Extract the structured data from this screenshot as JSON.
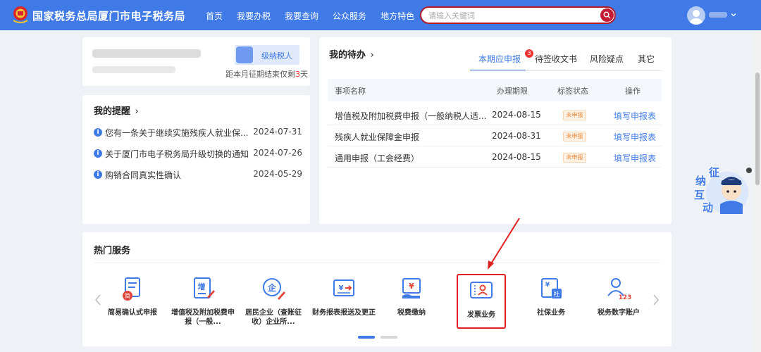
{
  "header": {
    "title": "国家税务总局厦门市电子税务局",
    "nav": [
      "首页",
      "我要办税",
      "我要查询",
      "公众服务",
      "地方特色"
    ],
    "search_placeholder": "请输入关键词"
  },
  "profile": {
    "taxpayer_type": "级纳税人",
    "deadline_prefix": "距本月征期结束仅剩",
    "deadline_days": "3",
    "deadline_suffix": "天"
  },
  "reminder": {
    "title": "我的提醒",
    "items": [
      {
        "text": "您有一条关于继续实施残疾人就业保...",
        "date": "2024-07-31"
      },
      {
        "text": "关于厦门市电子税务局升级切换的通知",
        "date": "2024-07-26"
      },
      {
        "text": "购销合同真实性确认",
        "date": "2024-05-29"
      }
    ]
  },
  "todo": {
    "title": "我的待办",
    "tabs": [
      "本期应申报",
      "待签收文书",
      "风险疑点",
      "其它"
    ],
    "active_tab_badge": "3",
    "columns": [
      "事项名称",
      "办理期限",
      "标签状态",
      "操作"
    ],
    "rows": [
      {
        "name": "增值税及附加税费申报（一般纳税人适...",
        "deadline": "2024-08-15",
        "status": "未申报",
        "action": "填写申报表"
      },
      {
        "name": "残疾人就业保障金申报",
        "deadline": "2024-08-31",
        "status": "未申报",
        "action": "填写申报表"
      },
      {
        "name": "通用申报（工会经费）",
        "deadline": "2024-08-15",
        "status": "未申报",
        "action": "填写申报表"
      }
    ]
  },
  "hot": {
    "title": "热门服务",
    "services": [
      {
        "label": "简易确认式申报",
        "icon": "document-seal-icon"
      },
      {
        "label": "增值税及附加税费申报（一般...",
        "icon": "vat-form-icon"
      },
      {
        "label": "居民企业（查账征收）企业所...",
        "icon": "enterprise-tax-icon"
      },
      {
        "label": "财务报表报送及更正",
        "icon": "financial-report-icon"
      },
      {
        "label": "税费缴纳",
        "icon": "tax-payment-icon"
      },
      {
        "label": "发票业务",
        "icon": "invoice-icon"
      },
      {
        "label": "社保业务",
        "icon": "social-security-icon"
      },
      {
        "label": "税务数字账户",
        "icon": "digital-account-icon"
      }
    ],
    "badge_small": "简",
    "badge_vat": "增",
    "badge_ent": "企",
    "badge_social": "社",
    "badge_123": "123",
    "yuan": "¥"
  },
  "mascot": {
    "chars": [
      "征",
      "纳",
      "互",
      "动"
    ]
  },
  "colors": {
    "primary": "#3f7ae6",
    "accent_red": "#c51a33",
    "highlight": "#e02020",
    "status_orange": "#e8893c"
  }
}
